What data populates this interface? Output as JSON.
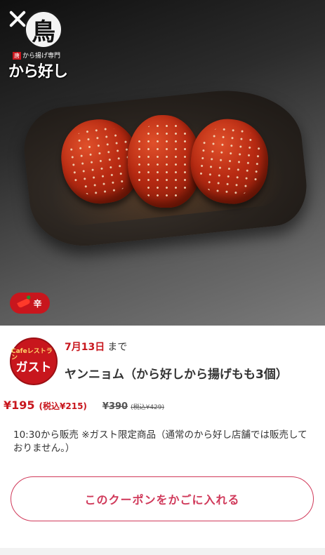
{
  "hero": {
    "brand_circle_char": "鳥",
    "brand_mark": "唐",
    "brand_sub": "から揚げ専門",
    "brand_name": "から好し",
    "spicy_label": "辛"
  },
  "store": {
    "logo_small": "Cafeレストラン",
    "logo_big": "ガスト"
  },
  "coupon": {
    "deadline_date": "7月13日",
    "deadline_suffix": "まで",
    "title": "ヤンニョム（から好しから揚げもも3個）",
    "price": "¥195",
    "price_tax": "(税込¥215)",
    "original_price": "¥390",
    "original_tax": "(税込¥429)",
    "note": "10:30から販売 ※ガスト限定商品（通常のから好し店舗では販売しておりません。）",
    "add_button_label": "このクーポンをかごに入れる"
  },
  "colors": {
    "accent_red": "#c8161d",
    "button_pink": "#d0395a"
  }
}
